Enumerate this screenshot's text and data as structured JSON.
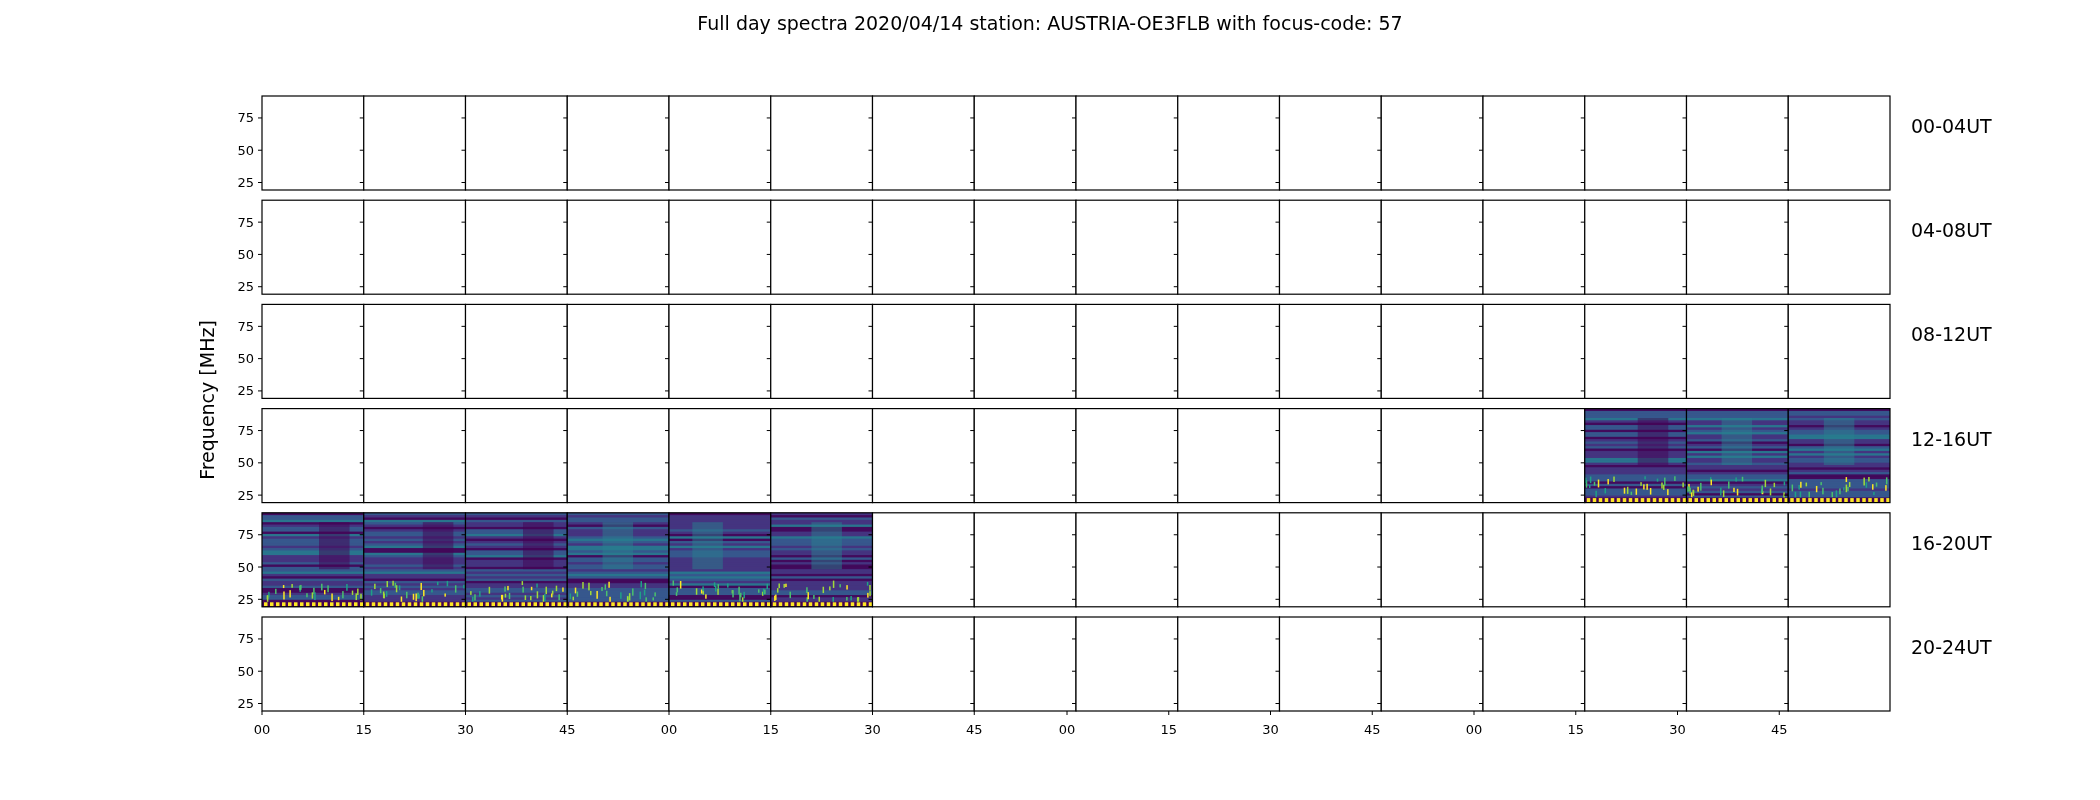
{
  "title": "Full day spectra 2020/04/14 station: AUSTRIA-OE3FLB with focus-code: 57",
  "ylabel": "Frequency [MHz]",
  "xticks": [
    "00",
    "15",
    "30",
    "45",
    "00",
    "15",
    "30",
    "45",
    "00",
    "15",
    "30",
    "45",
    "00",
    "15",
    "30",
    "45"
  ],
  "rows": [
    {
      "label": "00-04UT",
      "yticks": [
        "75",
        "50",
        "25"
      ],
      "panels": [
        false,
        false,
        false,
        false,
        false,
        false,
        false,
        false,
        false,
        false,
        false,
        false,
        false,
        false,
        false,
        false
      ]
    },
    {
      "label": "04-08UT",
      "yticks": [
        "75",
        "50",
        "25"
      ],
      "panels": [
        false,
        false,
        false,
        false,
        false,
        false,
        false,
        false,
        false,
        false,
        false,
        false,
        false,
        false,
        false,
        false
      ]
    },
    {
      "label": "08-12UT",
      "yticks": [
        "75",
        "50",
        "25"
      ],
      "panels": [
        false,
        false,
        false,
        false,
        false,
        false,
        false,
        false,
        false,
        false,
        false,
        false,
        false,
        false,
        false,
        false
      ]
    },
    {
      "label": "12-16UT",
      "yticks": [
        "75",
        "50",
        "25"
      ],
      "panels": [
        false,
        false,
        false,
        false,
        false,
        false,
        false,
        false,
        false,
        false,
        false,
        false,
        false,
        true,
        true,
        true
      ]
    },
    {
      "label": "16-20UT",
      "yticks": [
        "75",
        "50",
        "25"
      ],
      "panels": [
        true,
        true,
        true,
        true,
        true,
        true,
        false,
        false,
        false,
        false,
        false,
        false,
        false,
        false,
        false,
        false
      ]
    },
    {
      "label": "20-24UT",
      "yticks": [
        "75",
        "50",
        "25"
      ],
      "panels": [
        false,
        false,
        false,
        false,
        false,
        false,
        false,
        false,
        false,
        false,
        false,
        false,
        false,
        false,
        false,
        false
      ]
    }
  ]
}
